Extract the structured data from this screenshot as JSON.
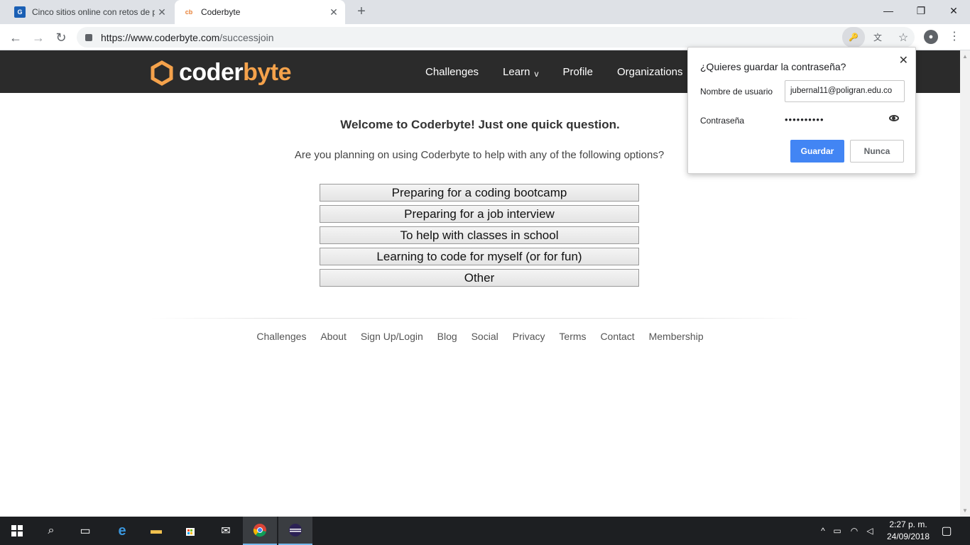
{
  "browser": {
    "tabs": [
      {
        "title": "Cinco sitios online con retos de p",
        "favicon": "cinco-favicon"
      },
      {
        "title": "Coderbyte",
        "favicon": "cb"
      }
    ],
    "url_host": "https://www.coderbyte.com",
    "url_path": "/successjoin"
  },
  "site": {
    "logo_part1": "coder",
    "logo_part2": "byte",
    "nav": {
      "challenges": "Challenges",
      "learn": "Learn",
      "learn_chevron": "v",
      "profile": "Profile",
      "organizations": "Organizations"
    },
    "accent_color": "#f5a24b"
  },
  "main": {
    "welcome": "Welcome to Coderbyte! Just one quick question.",
    "question": "Are you planning on using Coderbyte to help with any of the following options?",
    "options": [
      "Preparing for a coding bootcamp",
      "Preparing for a job interview",
      "To help with classes in school",
      "Learning to code for myself (or for fun)",
      "Other"
    ]
  },
  "footer": {
    "links": [
      "Challenges",
      "About",
      "Sign Up/Login",
      "Blog",
      "Social",
      "Privacy",
      "Terms",
      "Contact",
      "Membership"
    ]
  },
  "password_popup": {
    "title": "¿Quieres guardar la contraseña?",
    "username_label": "Nombre de usuario",
    "username_value": "jubernal11@poligran.edu.co",
    "password_label": "Contraseña",
    "password_value": "••••••••••",
    "save_label": "Guardar",
    "never_label": "Nunca"
  },
  "taskbar": {
    "time": "2:27 p. m.",
    "date": "24/09/2018"
  }
}
